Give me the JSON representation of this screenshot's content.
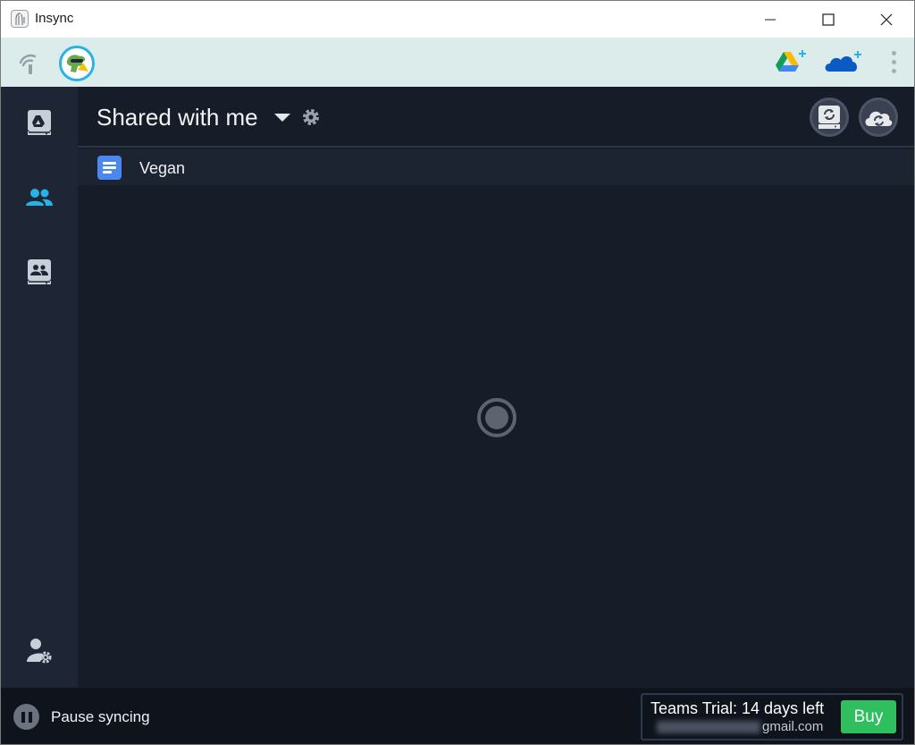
{
  "window": {
    "title": "Insync"
  },
  "toolbar": {
    "status_icon": "signal-icon",
    "avatar_icon": "dinosaur-avatar",
    "add_google_drive_icon": "google-drive-add-icon",
    "add_onedrive_icon": "onedrive-add-icon",
    "menu_icon": "kebab-menu-icon"
  },
  "sidebar": {
    "items": [
      {
        "name": "my-drive",
        "icon": "drive-icon",
        "active": false
      },
      {
        "name": "shared-with-me",
        "icon": "people-icon",
        "active": true
      },
      {
        "name": "shared-drives",
        "icon": "shared-drive-icon",
        "active": false
      }
    ],
    "bottom_icon": "account-settings-icon"
  },
  "header": {
    "title": "Shared with me"
  },
  "files": [
    {
      "name": "Vegan",
      "type": "google-doc"
    }
  ],
  "footer": {
    "pause_label": "Pause syncing",
    "trial_text": "Teams Trial: 14 days left",
    "email_suffix": "gmail.com",
    "buy_label": "Buy"
  },
  "colors": {
    "accent": "#27b3e6",
    "buy": "#2fbf5f",
    "background": "#161c28",
    "sidebar": "#1e2636",
    "toolbar": "#dbeceb"
  }
}
